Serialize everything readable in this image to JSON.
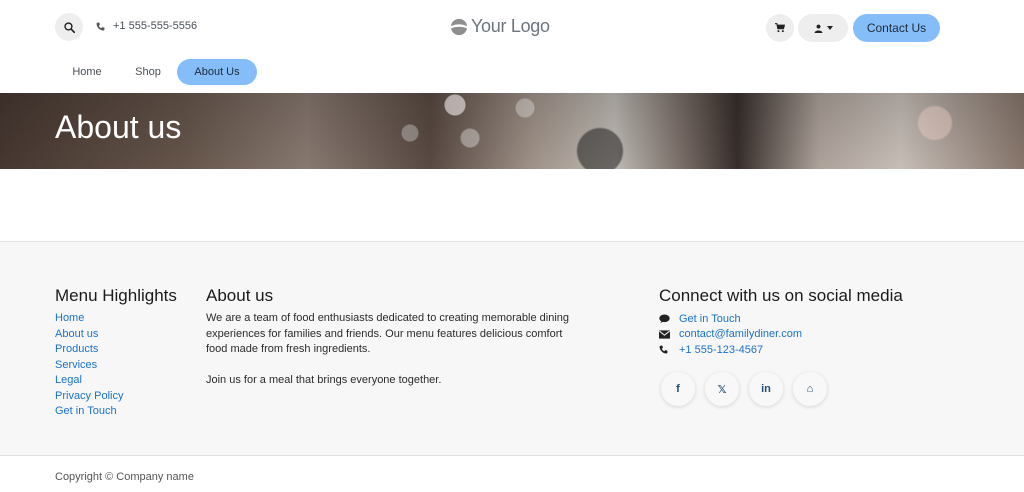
{
  "header": {
    "phone": "+1 555-555-5556",
    "logo_text": "Your Logo",
    "contact_button": "Contact Us"
  },
  "nav": [
    {
      "label": "Home"
    },
    {
      "label": "Shop"
    },
    {
      "label": "About Us",
      "active": true
    }
  ],
  "hero": {
    "title": "About us"
  },
  "footer": {
    "menu_title": "Menu Highlights",
    "menu_links": [
      "Home",
      "About us",
      "Products",
      "Services",
      "Legal",
      "Privacy Policy",
      "Get in Touch"
    ],
    "about_title": "About us",
    "about_p1": "We are a team of food enthusiasts dedicated to creating memorable dining experiences for families and friends. Our menu features delicious comfort food made from fresh ingredients.",
    "about_p2": "Join us for a meal that brings everyone together.",
    "social_title": "Connect with us on social media",
    "contacts": [
      {
        "icon": "comment-icon",
        "text": "Get in Touch"
      },
      {
        "icon": "envelope-icon",
        "text": "contact@familydiner.com"
      },
      {
        "icon": "phone-icon",
        "text": "+1 555-123-4567"
      }
    ],
    "socials": [
      {
        "icon": "facebook-icon",
        "glyph": "f"
      },
      {
        "icon": "x-icon",
        "glyph": "𝕏"
      },
      {
        "icon": "linkedin-icon",
        "glyph": "in"
      },
      {
        "icon": "home-icon",
        "glyph": "⌂"
      }
    ],
    "copyright": "Copyright © Company name"
  },
  "colors": {
    "accent": "#85bdf8",
    "link": "#1a73c9",
    "footer_bg": "#f7f7f7"
  }
}
